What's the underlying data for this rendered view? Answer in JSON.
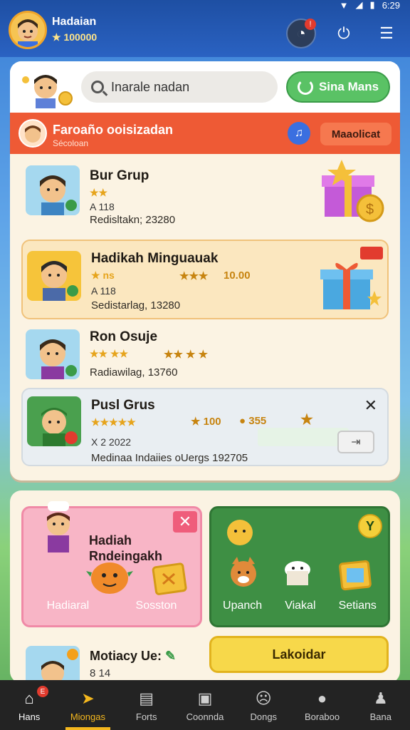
{
  "status_bar": {
    "time": "6:29"
  },
  "header": {
    "player_name": "Hadaian",
    "player_coins": "100000"
  },
  "search": {
    "placeholder": "Inarale nadan",
    "button_label": "Sina Mans"
  },
  "banner": {
    "title": "Faroaño ooisizadan",
    "subtitle": "Sécoloan",
    "button_label": "Maaolicat"
  },
  "rows": [
    {
      "title": "Bur Grup",
      "stars": "★★",
      "meta": "A 118",
      "sub": "Redisltakn; 23280"
    },
    {
      "title": "Hadikah Minguauak",
      "stars": "★ ns",
      "extra_stars": "★★★",
      "extra_value": "10.00",
      "meta": "A 118",
      "sub": "Sedistarlag, 13280"
    },
    {
      "title": "Ron Osuje",
      "stars": "★★ ★★",
      "extra_stars": "★★ ★ ★",
      "sub": "Radiawilag, 13760"
    },
    {
      "title": "Pusl Grus",
      "stars": "★★★★★",
      "extra_value": "100",
      "extra_value2": "355",
      "meta": "X 2 2022",
      "sub": "Medinaa Indaiies oUergs 192705"
    }
  ],
  "cards": {
    "pink": {
      "title": "Hadiah Rndeingakh",
      "labels": [
        "Hadiaral",
        "Sosston"
      ]
    },
    "green": {
      "badge": "Y",
      "labels": [
        "Upanch",
        "Viakal",
        "Setians"
      ]
    }
  },
  "bottom_row": {
    "title": "Motiacy Ue:",
    "sub": "8 14",
    "button_label": "Lakoidar"
  },
  "nav": [
    {
      "label": "Hans",
      "badge": "E"
    },
    {
      "label": "Miongas"
    },
    {
      "label": "Forts"
    },
    {
      "label": "Coonnda"
    },
    {
      "label": "Dongs"
    },
    {
      "label": "Boraboo"
    },
    {
      "label": "Bana"
    }
  ],
  "colors": {
    "accent_red": "#ee5a35",
    "accent_green": "#5ac265",
    "accent_yellow": "#f7d84a",
    "nav_active": "#f4b71e"
  }
}
